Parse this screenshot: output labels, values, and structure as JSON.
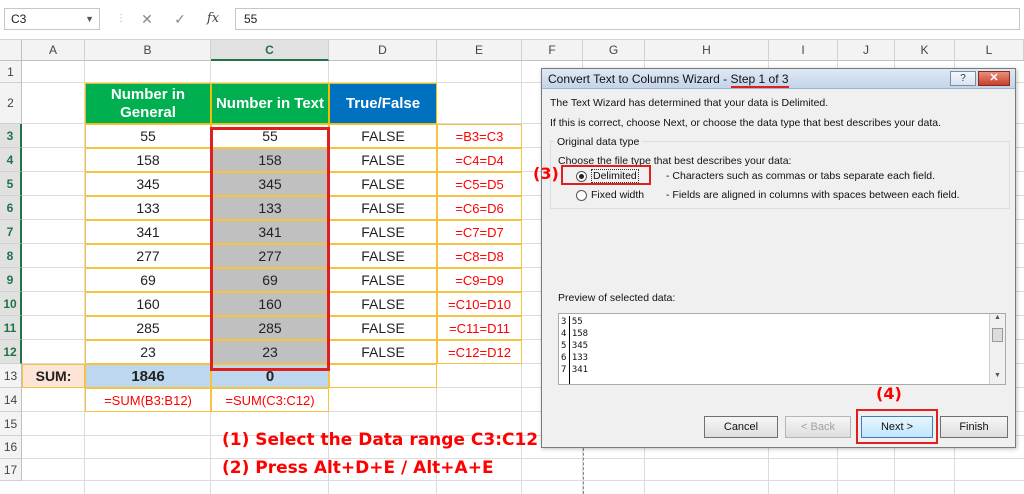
{
  "formula_bar": {
    "name_box": "C3",
    "value": "55",
    "fx_label": "fx"
  },
  "columns": [
    "A",
    "B",
    "C",
    "D",
    "E",
    "F",
    "G",
    "H",
    "I",
    "J",
    "K",
    "L"
  ],
  "rows": [
    "1",
    "2",
    "3",
    "4",
    "5",
    "6",
    "7",
    "8",
    "9",
    "10",
    "11",
    "12",
    "13",
    "14",
    "15",
    "16",
    "17"
  ],
  "headers": {
    "b": "Number in General",
    "c": "Number in Text",
    "d": "True/False"
  },
  "col_b": [
    "55",
    "158",
    "345",
    "133",
    "341",
    "277",
    "69",
    "160",
    "285",
    "23"
  ],
  "col_c": [
    "55",
    "158",
    "345",
    "133",
    "341",
    "277",
    "69",
    "160",
    "285",
    "23"
  ],
  "col_d": [
    "FALSE",
    "FALSE",
    "FALSE",
    "FALSE",
    "FALSE",
    "FALSE",
    "FALSE",
    "FALSE",
    "FALSE",
    "FALSE"
  ],
  "col_e": [
    "=B3=C3",
    "=C4=D4",
    "=C5=D5",
    "=C6=D6",
    "=C7=D7",
    "=C8=D8",
    "=C9=D9",
    "=C10=D10",
    "=C11=D11",
    "=C12=D12"
  ],
  "sum_row": {
    "label": "SUM:",
    "b": "1846",
    "c": "0"
  },
  "formula_row": {
    "b": "=SUM(B3:B12)",
    "c": "=SUM(C3:C12)"
  },
  "notes": {
    "line1": "(1) Select the Data range C3:C12",
    "line2": "(2) Press Alt+D+E / Alt+A+E"
  },
  "dialog": {
    "title": "Convert Text to Columns Wizard - ",
    "step": "Step 1 of 3",
    "help_label": "?",
    "close_label": "✕",
    "intro1": "The Text Wizard has determined that your data is Delimited.",
    "intro2": "If this is correct, choose Next, or choose the data type that best describes your data.",
    "group_title": "Original data type",
    "choose_label": "Choose the file type that best describes your data:",
    "option_delimited": "Delimited",
    "option_delimited_desc": "- Characters such as commas or tabs separate each field.",
    "option_fixed": "Fixed width",
    "option_fixed_desc": "- Fields are aligned in columns with spaces between each field.",
    "preview_label": "Preview of selected data:",
    "preview_lines": [
      "3 55",
      "4 158",
      "5 345",
      "6 133",
      "7 341"
    ],
    "buttons": {
      "cancel": "Cancel",
      "back": "< Back",
      "next": "Next >",
      "finish": "Finish"
    },
    "step3_mark": "(3)",
    "step4_mark": "(4)"
  },
  "colors": {
    "green_header": "#00b050",
    "blue_header": "#0070c0",
    "annotation_red": "#ff0000",
    "selection_green": "#217346"
  }
}
